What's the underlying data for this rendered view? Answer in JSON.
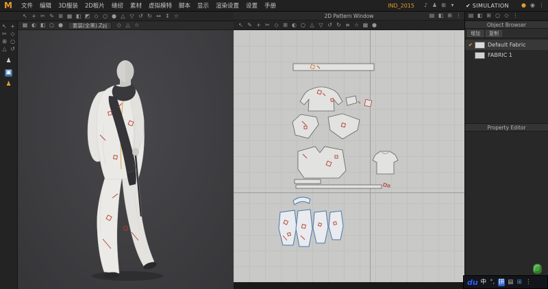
{
  "colors": {
    "accent_orange": "#e39b2d",
    "selection_blue": "#4878ad",
    "mark_red": "#b23b2c",
    "canvas_2d": "#c9c9c8",
    "viewport_3d": "#3e3e41",
    "panel_bg": "#282828",
    "ime_blue": "#2b5cff"
  },
  "titlebar": {
    "logo": "M",
    "menus": [
      "文件",
      "编辑",
      "3D服装",
      "2D板片",
      "缝纫",
      "素材",
      "虚拟模特",
      "脚本",
      "显示",
      "渲染设置",
      "设置",
      "手册"
    ],
    "badge": "IND_2015",
    "window_icons": [
      {
        "name": "volume-icon",
        "glyph": "♪"
      },
      {
        "name": "user-icon",
        "glyph": "♟"
      },
      {
        "name": "apps-icon",
        "glyph": "⊞"
      },
      {
        "name": "dropdown-icon",
        "glyph": "▾"
      }
    ]
  },
  "simulation": {
    "check_glyph": "✔",
    "label": "SIMULATION",
    "icons": [
      {
        "name": "status-dot-icon",
        "glyph": "●",
        "color": "#e39b2d"
      },
      {
        "name": "record-icon",
        "glyph": "◉"
      },
      {
        "name": "panel-more-icon",
        "glyph": "⋮"
      }
    ]
  },
  "toolbar_main": {
    "icons": [
      {
        "name": "select-tool-icon",
        "glyph": "↖"
      },
      {
        "name": "add-point-icon",
        "glyph": "+"
      },
      {
        "name": "scissors-icon",
        "glyph": "✂"
      },
      {
        "name": "pen-icon",
        "glyph": "✎"
      },
      {
        "name": "grid-icon",
        "glyph": "⊞"
      },
      {
        "name": "pattern-icon",
        "glyph": "▦"
      },
      {
        "name": "half-shade-icon",
        "glyph": "◧"
      },
      {
        "name": "corner-shade-icon",
        "glyph": "◩"
      },
      {
        "name": "diamond-tool-icon",
        "glyph": "◇"
      },
      {
        "name": "circle-tool-icon",
        "glyph": "○"
      },
      {
        "name": "dot-tool-icon",
        "glyph": "●"
      },
      {
        "name": "triangle-up-icon",
        "glyph": "△"
      },
      {
        "name": "triangle-down-icon",
        "glyph": "▽"
      },
      {
        "name": "undo-icon",
        "glyph": "↺"
      },
      {
        "name": "redo-icon",
        "glyph": "↻"
      },
      {
        "name": "arrow-horizontal-icon",
        "glyph": "↔"
      },
      {
        "name": "arrow-vertical-icon",
        "glyph": "↕"
      },
      {
        "name": "star-icon",
        "glyph": "☆"
      }
    ]
  },
  "left_tools": {
    "grid": [
      {
        "name": "pointer-tool-icon",
        "glyph": "↖"
      },
      {
        "name": "plus-tool-icon",
        "glyph": "+"
      },
      {
        "name": "cut-tool-icon",
        "glyph": "✂"
      },
      {
        "name": "diamond-icon",
        "glyph": "◇"
      },
      {
        "name": "mesh-icon",
        "glyph": "⊞"
      },
      {
        "name": "circle-icon",
        "glyph": "○"
      },
      {
        "name": "triangle-icon",
        "glyph": "△"
      },
      {
        "name": "rotate-icon",
        "glyph": "↺"
      }
    ],
    "singles": [
      {
        "name": "avatar-tool-icon",
        "glyph": "♟",
        "color": "#cfcfcf"
      },
      {
        "name": "garment-tab-icon",
        "glyph": "▣",
        "cls": "sel-blue"
      },
      {
        "name": "pose-tool-icon",
        "glyph": "♟",
        "color": "#dca23a"
      }
    ]
  },
  "viewport3d": {
    "tab_label": "套装(全黑).Zpj",
    "sub_icons_left": [
      {
        "name": "render-mode-icon",
        "glyph": "▦"
      },
      {
        "name": "shade-mode-icon",
        "glyph": "◐"
      },
      {
        "name": "texture-mode-icon",
        "glyph": "◧"
      },
      {
        "name": "wireframe-mode-icon",
        "glyph": "○"
      },
      {
        "name": "point-mode-icon",
        "glyph": "●"
      }
    ],
    "sub_icons_right": [
      {
        "name": "gizmo-icon",
        "glyph": "◇"
      },
      {
        "name": "camera-icon",
        "glyph": "△"
      },
      {
        "name": "bookmark-icon",
        "glyph": "☆"
      }
    ]
  },
  "viewport2d": {
    "title": "2D Pattern Window",
    "title_icons": [
      {
        "name": "layout-icon",
        "glyph": "▤"
      },
      {
        "name": "split-icon",
        "glyph": "◧"
      },
      {
        "name": "windows-icon",
        "glyph": "⊞"
      },
      {
        "name": "window-menu-icon",
        "glyph": "⋮"
      }
    ],
    "toolbar_icons": [
      {
        "name": "transform-pattern-icon",
        "glyph": "↖"
      },
      {
        "name": "edit-pattern-icon",
        "glyph": "✎"
      },
      {
        "name": "add-pattern-icon",
        "glyph": "+"
      },
      {
        "name": "trace-icon",
        "glyph": "✂"
      },
      {
        "name": "diamond-2d-icon",
        "glyph": "◇"
      },
      {
        "name": "grid-2d-icon",
        "glyph": "⊞"
      },
      {
        "name": "contrast-icon",
        "glyph": "◐"
      },
      {
        "name": "circle-2d-icon",
        "glyph": "○"
      },
      {
        "name": "triangle-up-2d-icon",
        "glyph": "△"
      },
      {
        "name": "triangle-down-2d-icon",
        "glyph": "▽"
      },
      {
        "name": "undo-2d-icon",
        "glyph": "↺"
      },
      {
        "name": "redo-2d-icon",
        "glyph": "↻"
      },
      {
        "name": "list-2d-icon",
        "glyph": "≡"
      },
      {
        "name": "star-2d-icon",
        "glyph": "☆"
      },
      {
        "name": "hatch-2d-icon",
        "glyph": "▦"
      },
      {
        "name": "dot-2d-icon",
        "glyph": "●"
      }
    ],
    "pieces": [
      "waistband-strip",
      "bodice-back",
      "side-panel",
      "small-square-patch",
      "sleeve-left",
      "sleeve-right",
      "bodice-front",
      "t-shirt-panel",
      "binding-strip-short",
      "binding-strip-long",
      "collar-band",
      "pants-panel-1",
      "pants-panel-2",
      "pants-panel-3",
      "pants-panel-4"
    ]
  },
  "object_browser": {
    "title": "Object Browser",
    "buttons": [
      "增加",
      "复制"
    ],
    "check_glyph": "✔",
    "fabrics": [
      {
        "name": "Default Fabric",
        "selected": true,
        "swatch": "#dcdcda"
      },
      {
        "name": "FABRIC 1",
        "selected": false,
        "swatch": "#d2d2d0"
      }
    ],
    "panel_toolbar_icons": [
      {
        "name": "list-view-icon",
        "glyph": "▤"
      },
      {
        "name": "split-view-icon",
        "glyph": "◧"
      },
      {
        "name": "add-view-icon",
        "glyph": "⊞"
      },
      {
        "name": "sync-icon",
        "glyph": "○"
      },
      {
        "name": "filter-icon",
        "glyph": "◇"
      },
      {
        "name": "more-icon",
        "glyph": "⋮"
      }
    ]
  },
  "property_editor": {
    "title": "Property Editor"
  },
  "taskbar": {
    "logo": "du",
    "items": [
      {
        "name": "ime-language-mode",
        "glyph": "中",
        "color": "#eeeeee"
      },
      {
        "name": "ime-punctuation",
        "glyph": "°,",
        "color": "#bbbbbb"
      },
      {
        "name": "ime-pinyin-icon",
        "glyph": "拼",
        "color": "#ffffff",
        "bg": "#2d62c9"
      },
      {
        "name": "ime-keyboard-icon",
        "glyph": "▤",
        "color": "#bbbbbb"
      },
      {
        "name": "ime-apps-icon",
        "glyph": "⊞",
        "color": "#5b9bd5"
      },
      {
        "name": "ime-more-icon",
        "glyph": "⋮",
        "color": "#bbbbbb"
      }
    ]
  }
}
